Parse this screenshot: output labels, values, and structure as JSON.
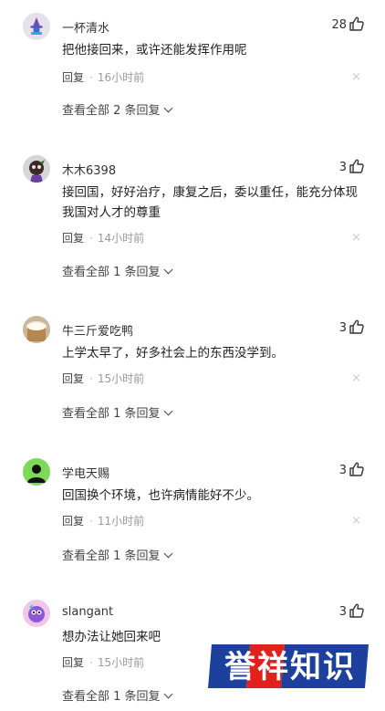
{
  "comments": [
    {
      "username": "一杯清水",
      "likes": "28",
      "text": "把他接回来，或许还能发挥作用呢",
      "reply_label": "回复",
      "time": "16小时前",
      "view_all": "查看全部 2 条回复",
      "avatar": "wizard-avatar"
    },
    {
      "username": "木木6398",
      "likes": "3",
      "text": "接回国，好好治疗，康复之后，委以重任，能充分体现我国对人才的尊重",
      "reply_label": "回复",
      "time": "14小时前",
      "view_all": "查看全部 1 条回复",
      "avatar": "cartoon-avatar"
    },
    {
      "username": "牛三斤爱吃鸭",
      "likes": "3",
      "text": "上学太早了，好多社会上的东西没学到。",
      "reply_label": "回复",
      "time": "15小时前",
      "view_all": "查看全部 1 条回复",
      "avatar": "drink-avatar"
    },
    {
      "username": "学电天赐",
      "likes": "3",
      "text": "回国换个环境，也许病情能好不少。",
      "reply_label": "回复",
      "time": "11小时前",
      "view_all": "查看全部 1 条回复",
      "avatar": "silhouette-avatar"
    },
    {
      "username": "slangant",
      "likes": "3",
      "text": "想办法让她回来吧",
      "reply_label": "回复",
      "time": "15小时前",
      "view_all": "查看全部 1 条回复",
      "avatar": "colorful-avatar"
    }
  ],
  "watermark": {
    "text": "誉祥知识"
  },
  "colors": {
    "watermark_blue": "#1d3f9e",
    "watermark_red": "#e0211c"
  }
}
